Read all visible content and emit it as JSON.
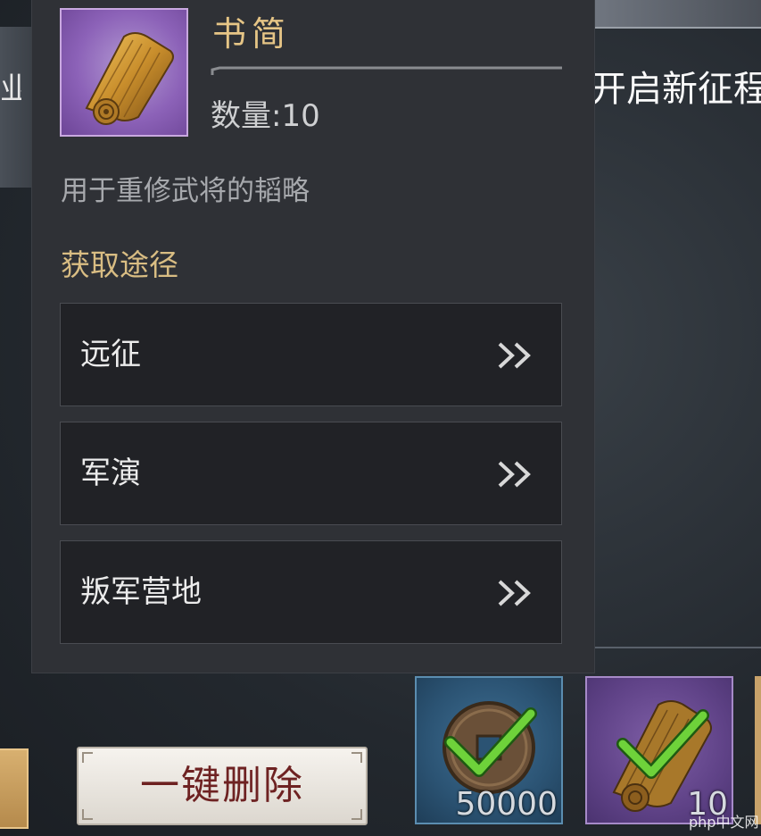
{
  "item": {
    "name": "书简",
    "quantity_label": "数量:10",
    "description": "用于重修武将的韬略",
    "icon": "bamboo-scroll-icon"
  },
  "sources": {
    "title": "获取途径",
    "items": [
      {
        "label": "远征"
      },
      {
        "label": "军演"
      },
      {
        "label": "叛军营地"
      }
    ]
  },
  "background": {
    "left_tab_label": "业",
    "right_title": "开启新征程"
  },
  "actions": {
    "delete_all_label": "一键删除"
  },
  "reward_slots": [
    {
      "icon": "copper-coin-icon",
      "count": "50000",
      "selected": true
    },
    {
      "icon": "bamboo-scroll-icon",
      "count": "10",
      "selected": true
    }
  ],
  "watermark": "php中文网",
  "colors": {
    "item_name": "#e6c586",
    "section_title": "#d9bd83",
    "panel_bg": "#2f3136",
    "row_bg": "#212226",
    "check": "#6ed23a"
  }
}
